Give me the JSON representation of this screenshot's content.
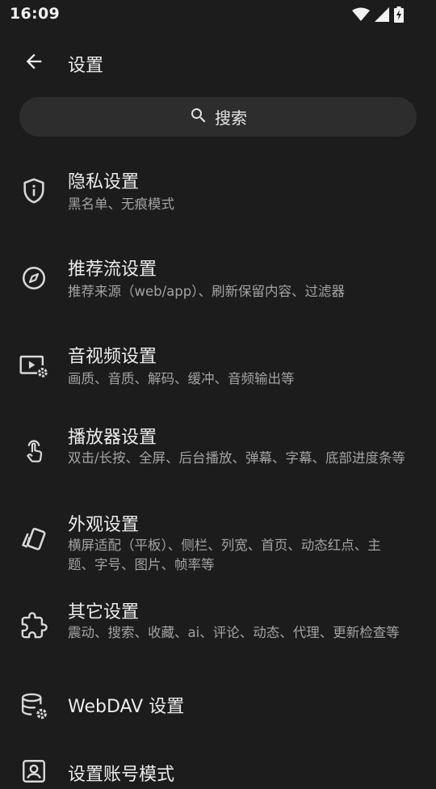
{
  "status_bar": {
    "time": "16:09"
  },
  "app_bar": {
    "title": "设置"
  },
  "search": {
    "label": "搜索"
  },
  "settings": [
    {
      "icon": "shield-info-icon",
      "title": "隐私设置",
      "subtitle": "黑名单、无痕模式"
    },
    {
      "icon": "compass-icon",
      "title": "推荐流设置",
      "subtitle": "推荐来源（web/app）、刷新保留内容、过滤器"
    },
    {
      "icon": "video-settings-icon",
      "title": "音视频设置",
      "subtitle": "画质、音质、解码、缓冲、音频输出等"
    },
    {
      "icon": "touch-gesture-icon",
      "title": "播放器设置",
      "subtitle": "双击/长按、全屏、后台播放、弹幕、字幕、底部进度条等"
    },
    {
      "icon": "palette-cards-icon",
      "title": "外观设置",
      "subtitle": "横屏适配（平板）、侧栏、列宽、首页、动态红点、主题、字号、图片、帧率等"
    },
    {
      "icon": "puzzle-icon",
      "title": "其它设置",
      "subtitle": "震动、搜索、收藏、ai、评论、动态、代理、更新检查等"
    },
    {
      "icon": "database-settings-icon",
      "title": "WebDAV 设置",
      "subtitle": ""
    },
    {
      "icon": "account-box-icon",
      "title": "设置账号模式",
      "subtitle": ""
    }
  ]
}
